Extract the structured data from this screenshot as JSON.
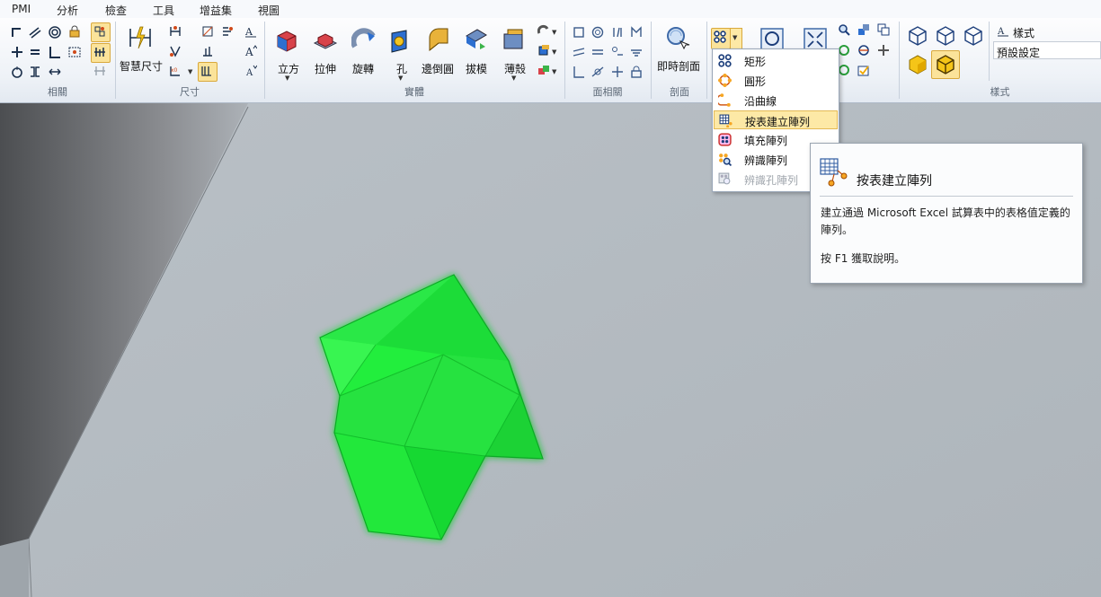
{
  "menubar": {
    "items": [
      {
        "label": "PMI"
      },
      {
        "label": "分析"
      },
      {
        "label": "檢查"
      },
      {
        "label": "工具"
      },
      {
        "label": "增益集"
      },
      {
        "label": "視圖"
      }
    ]
  },
  "ribbon": {
    "groups": {
      "related": "相關",
      "dimension": "尺寸",
      "solid": "實體",
      "face_related": "面相關",
      "section": "剖面",
      "style": "樣式"
    },
    "buttons": {
      "smart_dimension": "智慧尺寸",
      "cube": "立方",
      "extrude": "拉伸",
      "revolve": "旋轉",
      "hole": "孔",
      "round": "邊倒圓",
      "draft": "拔模",
      "thin_wall": "薄殼",
      "live_section": "即時剖面"
    },
    "style_panel": {
      "style_label": "樣式",
      "style_value": "預設設定"
    }
  },
  "pattern_menu": {
    "items": [
      {
        "label": "矩形",
        "icon": "rectangular-pattern-icon",
        "enabled": true
      },
      {
        "label": "圓形",
        "icon": "circular-pattern-icon",
        "enabled": true
      },
      {
        "label": "沿曲線",
        "icon": "curve-pattern-icon",
        "enabled": true
      },
      {
        "label": "按表建立陣列",
        "icon": "table-pattern-icon",
        "enabled": true,
        "selected": true
      },
      {
        "label": "填充陣列",
        "icon": "fill-pattern-icon",
        "enabled": true
      },
      {
        "label": "辨識陣列",
        "icon": "recognize-pattern-icon",
        "enabled": true
      },
      {
        "label": "辨識孔陣列",
        "icon": "recognize-hole-pattern-icon",
        "enabled": false
      }
    ]
  },
  "tooltip": {
    "title": "按表建立陣列",
    "description": "建立通過 Microsoft Excel 試算表中的表格值定義的陣列。",
    "help": "按 F1 獲取說明。"
  },
  "colors": {
    "accent_highlight": "#fbe39a",
    "model_green": "#1ee63a",
    "viewport_plate": "#b3bac1"
  }
}
